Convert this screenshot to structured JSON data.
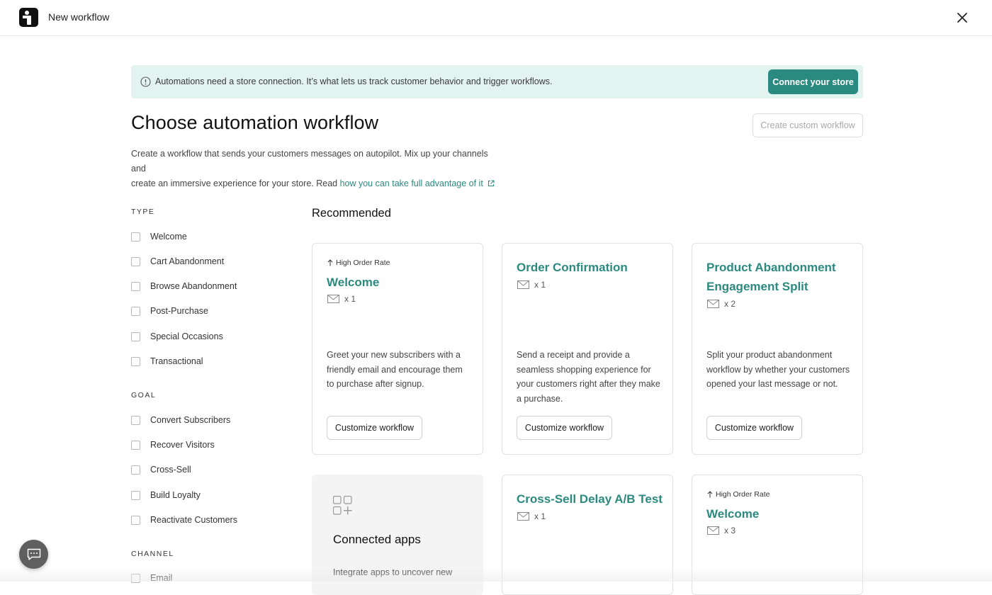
{
  "header": {
    "title": "New workflow",
    "logo_icon": "brand-logo-icon",
    "close_icon": "close-icon"
  },
  "banner": {
    "text": "Automations need a store connection. It’s what lets us track customer behavior and trigger workflows.",
    "button_label": "Connect your store",
    "icon": "info-icon",
    "background": "#e3f4f0",
    "accent": "#2b8a80"
  },
  "page": {
    "title": "Choose automation workflow",
    "custom_button_label": "Create custom workflow",
    "description_line1": "Create a workflow that sends your customers messages on autopilot. Mix up your channels and",
    "description_line2": "create an immersive experience for your store. Read ",
    "description_link": "how you can take full advantage of it"
  },
  "filters": {
    "type_heading": "TYPE",
    "type": [
      "Welcome",
      "Cart Abandonment",
      "Browse Abandonment",
      "Post-Purchase",
      "Special Occasions",
      "Transactional"
    ],
    "goal_heading": "GOAL",
    "goal": [
      "Convert Subscribers",
      "Recover Visitors",
      "Cross-Sell",
      "Build Loyalty",
      "Reactivate Customers"
    ],
    "channel_heading": "CHANNEL",
    "channel": [
      "Email"
    ]
  },
  "recommended": {
    "title": "Recommended",
    "cards": [
      {
        "badge": "High Order Rate",
        "title": "Welcome",
        "count": "x 1",
        "description": "Greet your new subscribers with a friendly email and encourage them to purchase after signup.",
        "button": "Customize workflow"
      },
      {
        "badge": "",
        "title": "Order Confirmation",
        "count": "x 1",
        "description": "Send a receipt and provide a seamless shopping experience for your customers right after they make a purchase.",
        "button": "Customize workflow"
      },
      {
        "badge": "",
        "title": "Product Abandonment Engagement Split",
        "count": "x 2",
        "description": "Split your product abandonment workflow by whether your customers opened your last message or not.",
        "button": "Customize workflow"
      },
      {
        "badge": "",
        "title": "Cross-Sell Delay A/B Test",
        "count": "x 1",
        "description": "",
        "button": ""
      },
      {
        "badge": "High Order Rate",
        "title": "Welcome",
        "count": "x 3",
        "description": "",
        "button": ""
      }
    ]
  },
  "apps_card": {
    "title": "Connected apps",
    "description": "Integrate apps to uncover new",
    "icon": "apps-grid-icon"
  },
  "chat": {
    "icon": "chat-icon"
  }
}
